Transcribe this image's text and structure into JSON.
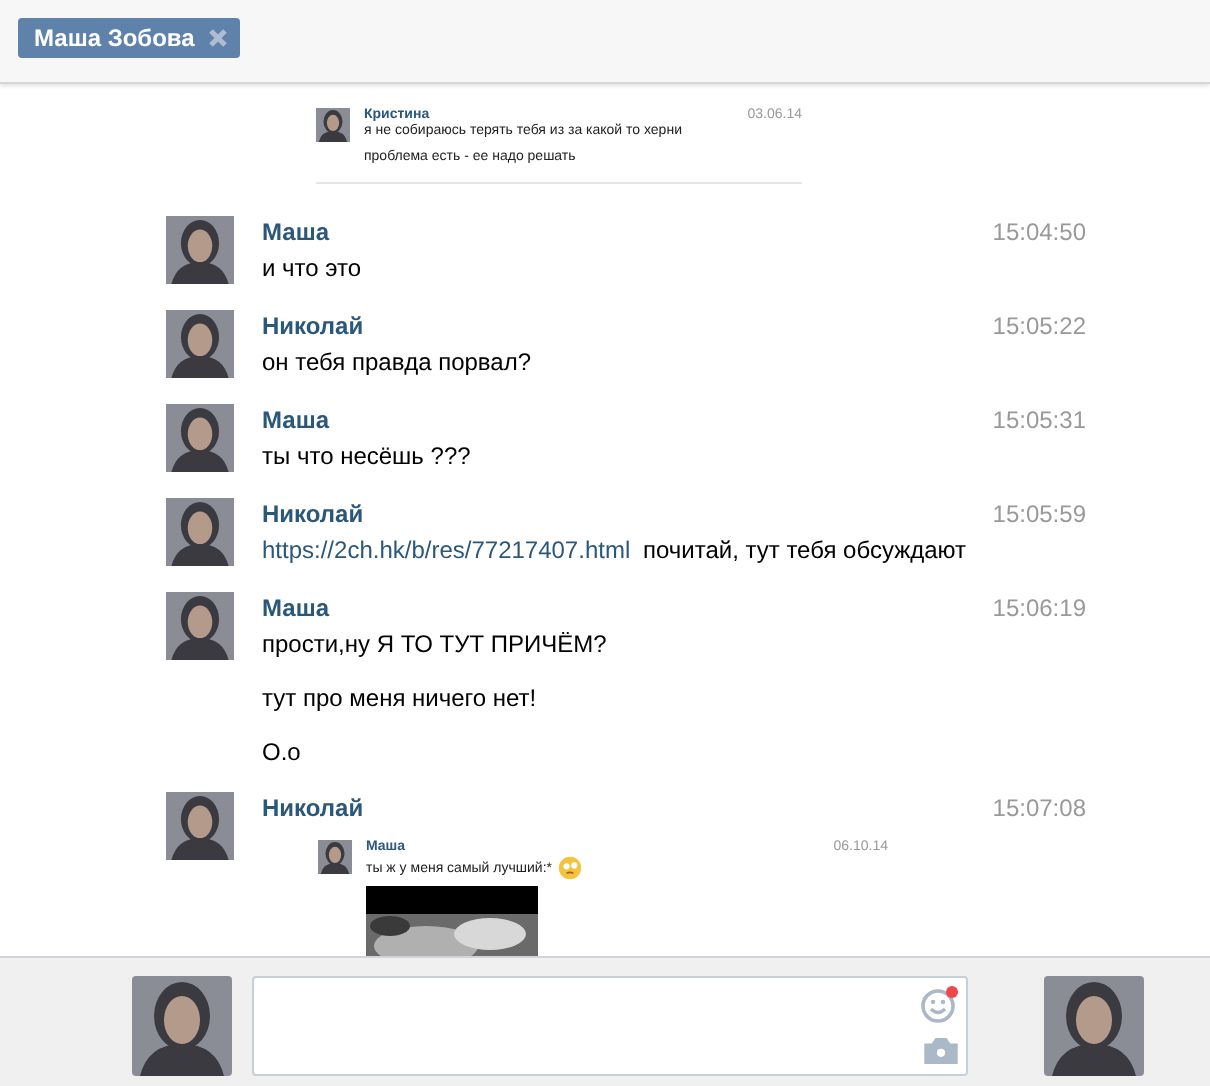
{
  "tab": {
    "label": "Маша Зобова"
  },
  "top_forward": {
    "name": "Кристина",
    "date": "03.06.14",
    "lines": [
      "я не собираюсь терять тебя из за какой то херни",
      "проблема есть - ее надо решать"
    ]
  },
  "messages": [
    {
      "name": "Маша",
      "time": "15:04:50",
      "lines": [
        {
          "text": "и что это"
        }
      ]
    },
    {
      "name": "Николай",
      "time": "15:05:22",
      "lines": [
        {
          "text": "он тебя правда порвал?"
        }
      ]
    },
    {
      "name": "Маша",
      "time": "15:05:31",
      "lines": [
        {
          "text": "ты что несёшь ???"
        }
      ]
    },
    {
      "name": "Николай",
      "time": "15:05:59",
      "lines": [
        {
          "link": "https://2ch.hk/b/res/77217407.html",
          "text": "почитай, тут тебя обсуждают"
        }
      ]
    },
    {
      "name": "Маша",
      "time": "15:06:19",
      "lines": [
        {
          "text": "прости,ну Я ТО ТУТ ПРИЧЁМ?"
        },
        {
          "text": "тут про меня ничего нет!"
        },
        {
          "text": "О.о"
        }
      ]
    },
    {
      "name": "Николай",
      "time": "15:07:08",
      "forward": {
        "name": "Маша",
        "date": "06.10.14",
        "text": "ты ж у меня самый лучший:*",
        "emoji": true,
        "picture": true
      }
    }
  ],
  "composer": {
    "emoji_notification": true
  }
}
